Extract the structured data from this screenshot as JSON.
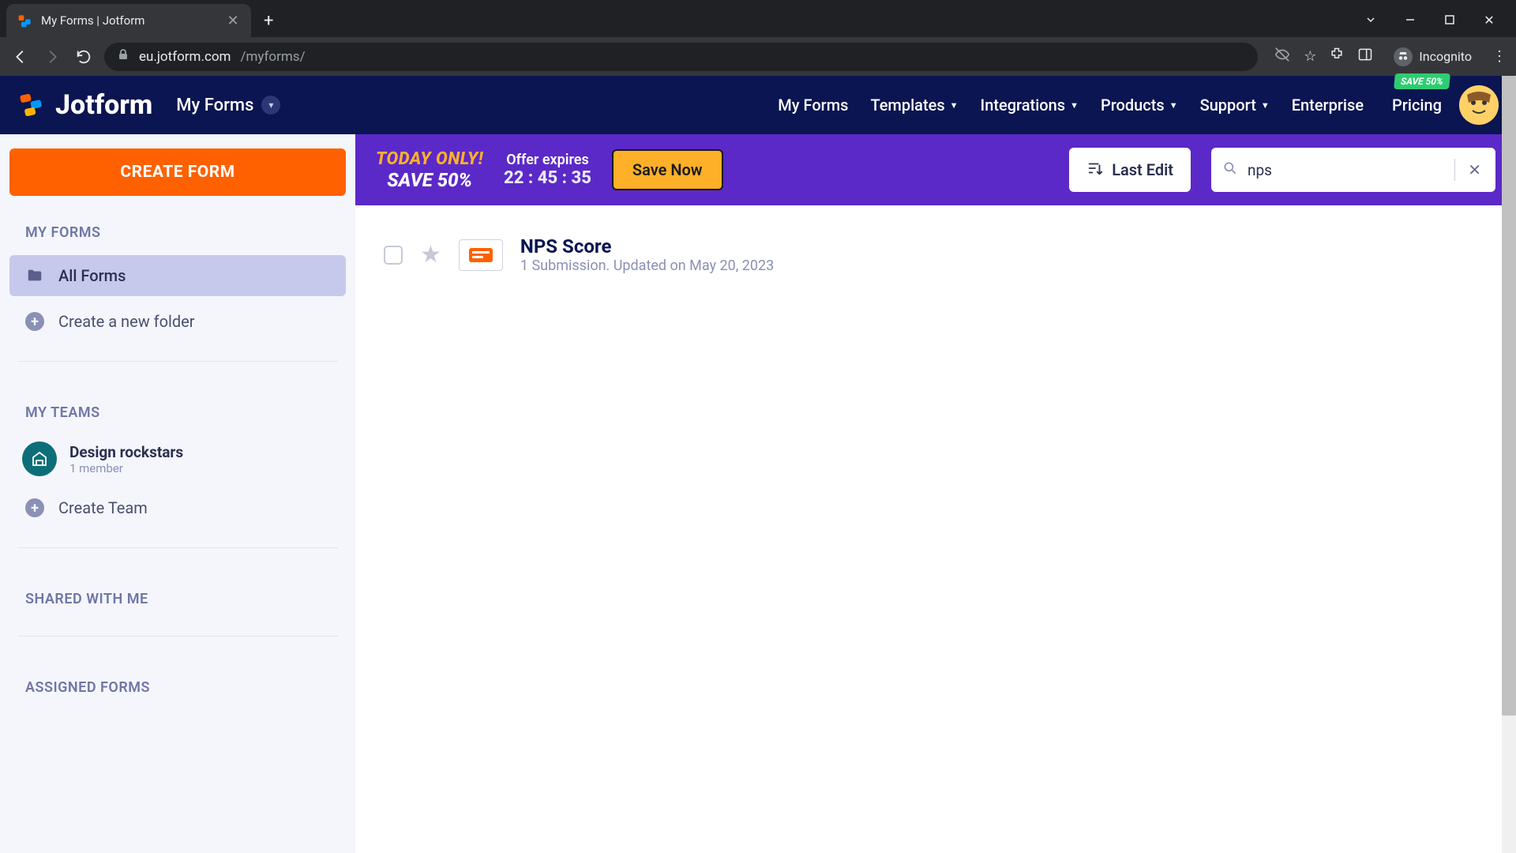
{
  "browser": {
    "tab_title": "My Forms | Jotform",
    "url_host": "eu.jotform.com",
    "url_path": "/myforms/",
    "incognito_label": "Incognito"
  },
  "header": {
    "brand": "Jotform",
    "dropdown_label": "My Forms",
    "nav": [
      "My Forms",
      "Templates",
      "Integrations",
      "Products",
      "Support",
      "Enterprise"
    ],
    "pricing_label": "Pricing",
    "save_badge": "SAVE 50%"
  },
  "sidebar": {
    "create_label": "CREATE FORM",
    "sections": {
      "my_forms": "MY FORMS",
      "my_teams": "MY TEAMS",
      "shared": "SHARED WITH ME",
      "assigned": "ASSIGNED FORMS"
    },
    "all_forms": "All Forms",
    "new_folder": "Create a new folder",
    "team": {
      "name": "Design rockstars",
      "meta": "1 member"
    },
    "create_team": "Create Team"
  },
  "promo": {
    "line1": "TODAY ONLY!",
    "line2": "SAVE 50%",
    "offer_label": "Offer expires",
    "offer_time": "22 : 45 : 35",
    "save_now": "Save Now"
  },
  "toolbar": {
    "sort_label": "Last Edit",
    "search_value": "nps"
  },
  "forms": [
    {
      "title": "NPS Score",
      "sub": "1 Submission. Updated on May 20, 2023"
    }
  ]
}
